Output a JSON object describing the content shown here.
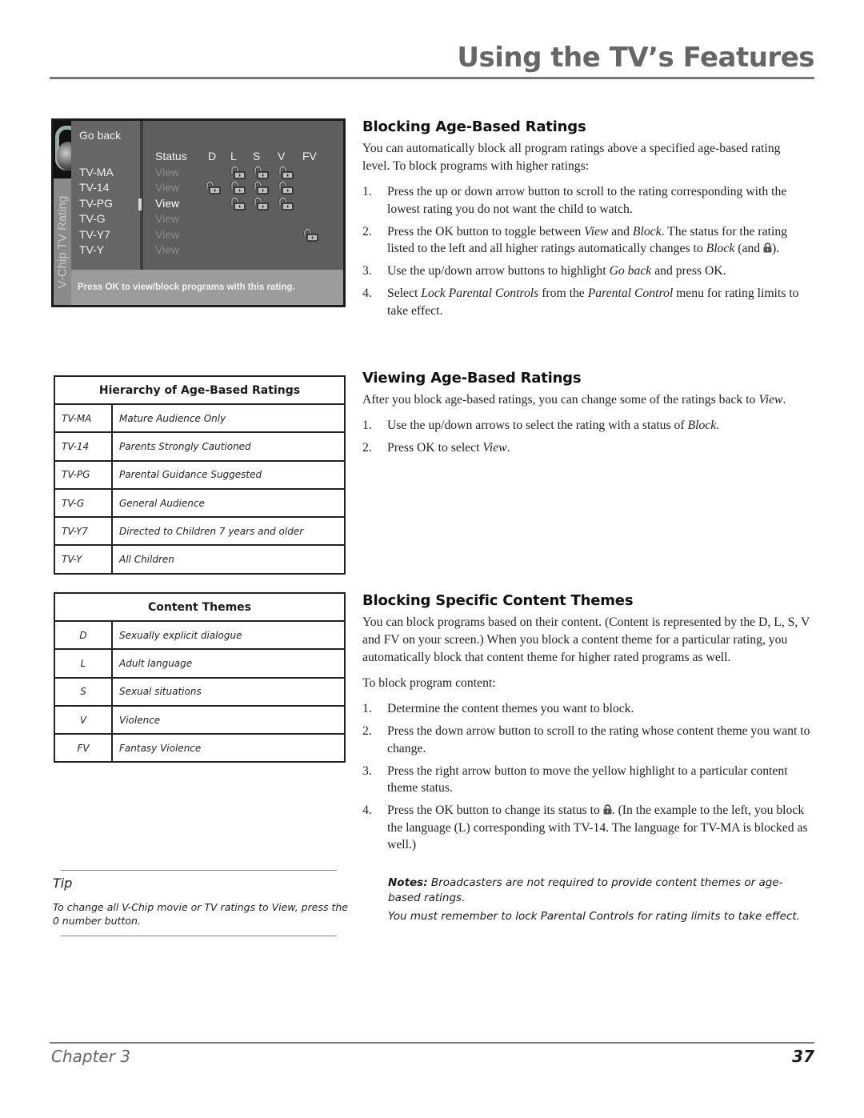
{
  "header": {
    "title": "Using the TV’s Features"
  },
  "tv_screen": {
    "vertical_title": "V-Chip TV Rating",
    "go_back": "Go back",
    "status_header": "Status",
    "columns": [
      "D",
      "L",
      "S",
      "V",
      "FV"
    ],
    "rows": [
      {
        "rating": "TV-MA",
        "status": "View",
        "active": false,
        "locks": {
          "D": false,
          "L": true,
          "S": true,
          "V": true,
          "FV": false
        }
      },
      {
        "rating": "TV-14",
        "status": "View",
        "active": false,
        "locks": {
          "D": true,
          "L": true,
          "S": true,
          "V": true,
          "FV": false
        }
      },
      {
        "rating": "TV-PG",
        "status": "View",
        "active": true,
        "locks": {
          "D": false,
          "L": true,
          "S": true,
          "V": true,
          "FV": false
        }
      },
      {
        "rating": "TV-G",
        "status": "View",
        "active": false,
        "locks": {
          "D": false,
          "L": false,
          "S": false,
          "V": false,
          "FV": false
        }
      },
      {
        "rating": "TV-Y7",
        "status": "View",
        "active": false,
        "locks": {
          "D": false,
          "L": false,
          "S": false,
          "V": false,
          "FV": true
        }
      },
      {
        "rating": "TV-Y",
        "status": "View",
        "active": false,
        "locks": {
          "D": false,
          "L": false,
          "S": false,
          "V": false,
          "FV": false
        }
      }
    ],
    "lock_icon": "unlocked-padlock-icon",
    "footer_text": "Press OK to view/block programs with this rating."
  },
  "hierarchy_table": {
    "title": "Hierarchy of Age-Based Ratings",
    "rows": [
      {
        "code": "TV-MA",
        "desc": "Mature Audience Only"
      },
      {
        "code": "TV-14",
        "desc": "Parents Strongly Cautioned"
      },
      {
        "code": "TV-PG",
        "desc": "Parental Guidance Suggested"
      },
      {
        "code": "TV-G",
        "desc": "General Audience"
      },
      {
        "code": "TV-Y7",
        "desc": "Directed to Children 7 years and older"
      },
      {
        "code": "TV-Y",
        "desc": "All Children"
      }
    ]
  },
  "themes_table": {
    "title": "Content Themes",
    "rows": [
      {
        "code": "D",
        "desc": "Sexually explicit dialogue"
      },
      {
        "code": "L",
        "desc": "Adult language"
      },
      {
        "code": "S",
        "desc": "Sexual situations"
      },
      {
        "code": "V",
        "desc": "Violence"
      },
      {
        "code": "FV",
        "desc": "Fantasy Violence"
      }
    ]
  },
  "tip": {
    "title": "Tip",
    "body": "To change all V-Chip movie or TV ratings to View, press the 0 number button."
  },
  "sections": {
    "blocking": {
      "heading": "Blocking Age-Based Ratings",
      "intro": "You can automatically block all program ratings above a specified age-based rating level. To block programs with higher ratings:",
      "steps": [
        {
          "n": "1.",
          "parts": [
            {
              "t": "Press the up or down arrow button to scroll to the rating corresponding with the lowest rating you do not want the child to watch."
            }
          ]
        },
        {
          "n": "2.",
          "parts": [
            {
              "t": "Press the OK button to toggle between "
            },
            {
              "t": "View",
              "i": true
            },
            {
              "t": " and "
            },
            {
              "t": "Block",
              "i": true
            },
            {
              "t": ". The status for the rating listed to the left and all higher ratings automatically changes to "
            },
            {
              "t": "Block",
              "i": true
            },
            {
              "t": " (and "
            },
            {
              "lock": true
            },
            {
              "t": ")."
            }
          ]
        },
        {
          "n": "3.",
          "parts": [
            {
              "t": "Use the up/down arrow buttons to highlight "
            },
            {
              "t": "Go back",
              "i": true
            },
            {
              "t": " and press OK."
            }
          ]
        },
        {
          "n": "4.",
          "parts": [
            {
              "t": "Select "
            },
            {
              "t": "Lock Parental Controls",
              "i": true
            },
            {
              "t": " from the "
            },
            {
              "t": "Parental Control",
              "i": true
            },
            {
              "t": " menu for rating limits to take effect."
            }
          ]
        }
      ]
    },
    "viewing": {
      "heading": "Viewing Age-Based Ratings",
      "intro_parts": [
        {
          "t": "After you block age-based ratings, you can change some of the ratings back to "
        },
        {
          "t": "View",
          "i": true
        },
        {
          "t": "."
        }
      ],
      "steps": [
        {
          "n": "1.",
          "parts": [
            {
              "t": "Use the up/down arrows to select the rating with a status of "
            },
            {
              "t": "Block",
              "i": true
            },
            {
              "t": "."
            }
          ]
        },
        {
          "n": "2.",
          "parts": [
            {
              "t": "Press OK to select "
            },
            {
              "t": "View",
              "i": true
            },
            {
              "t": "."
            }
          ]
        }
      ]
    },
    "themes": {
      "heading": "Blocking Specific Content Themes",
      "intro": "You can block programs based on their content. (Content is represented by the D, L, S, V and FV on your screen.) When you block a content theme for a particular rating, you automatically block that content theme for higher rated programs as well.",
      "lead": "To block program content:",
      "steps": [
        {
          "n": "1.",
          "parts": [
            {
              "t": "Determine the content themes you want to block."
            }
          ]
        },
        {
          "n": "2.",
          "parts": [
            {
              "t": "Press the down arrow button to scroll to the rating whose content theme you want to change."
            }
          ]
        },
        {
          "n": "3.",
          "parts": [
            {
              "t": "Press the right arrow button to move the yellow highlight to a particular content theme status."
            }
          ]
        },
        {
          "n": "4.",
          "parts": [
            {
              "t": "Press the OK button to change its status to "
            },
            {
              "lock": true
            },
            {
              "t": ". (In the example to the left, you block the language (L) corresponding with TV-14. The language for TV-MA is blocked as well.)"
            }
          ]
        }
      ]
    }
  },
  "notes": {
    "label": "Notes:",
    "line1": " Broadcasters are not required to provide content themes or age-based ratings.",
    "line2": "You must remember to lock Parental Controls for rating limits to take effect."
  },
  "footer": {
    "chapter": "Chapter 3",
    "page": "37"
  }
}
